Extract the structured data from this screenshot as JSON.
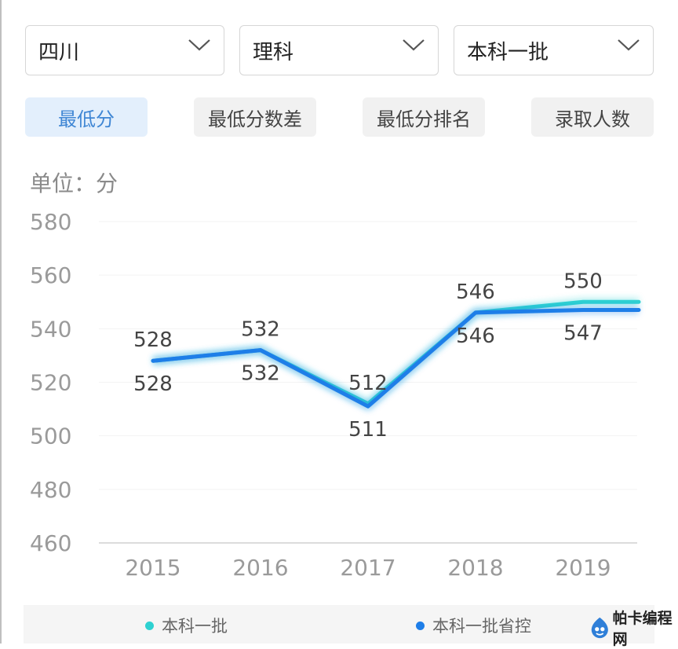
{
  "filters": {
    "province": "四川",
    "subject": "理科",
    "batch": "本科一批"
  },
  "tabs": [
    {
      "label": "最低分",
      "active": true
    },
    {
      "label": "最低分数差",
      "active": false
    },
    {
      "label": "最低分排名",
      "active": false
    },
    {
      "label": "录取人数",
      "active": false
    }
  ],
  "unit_label": "单位：分",
  "watermark": "帕卡编程网",
  "colors": {
    "accent": "#3f86d4",
    "series_1": "#2ed1d1",
    "series_2": "#1e7ee8"
  },
  "chart_data": {
    "type": "line",
    "x": [
      "2015",
      "2016",
      "2017",
      "2018",
      "2019"
    ],
    "ylim": [
      460,
      580
    ],
    "yticks": [
      580,
      560,
      540,
      520,
      500,
      480,
      460
    ],
    "grid": true,
    "legend": "bottom",
    "series": [
      {
        "name": "本科一批",
        "values": [
          528,
          532,
          512,
          546,
          550
        ]
      },
      {
        "name": "本科一批省控",
        "values": [
          528,
          532,
          511,
          546,
          547
        ]
      }
    ]
  }
}
